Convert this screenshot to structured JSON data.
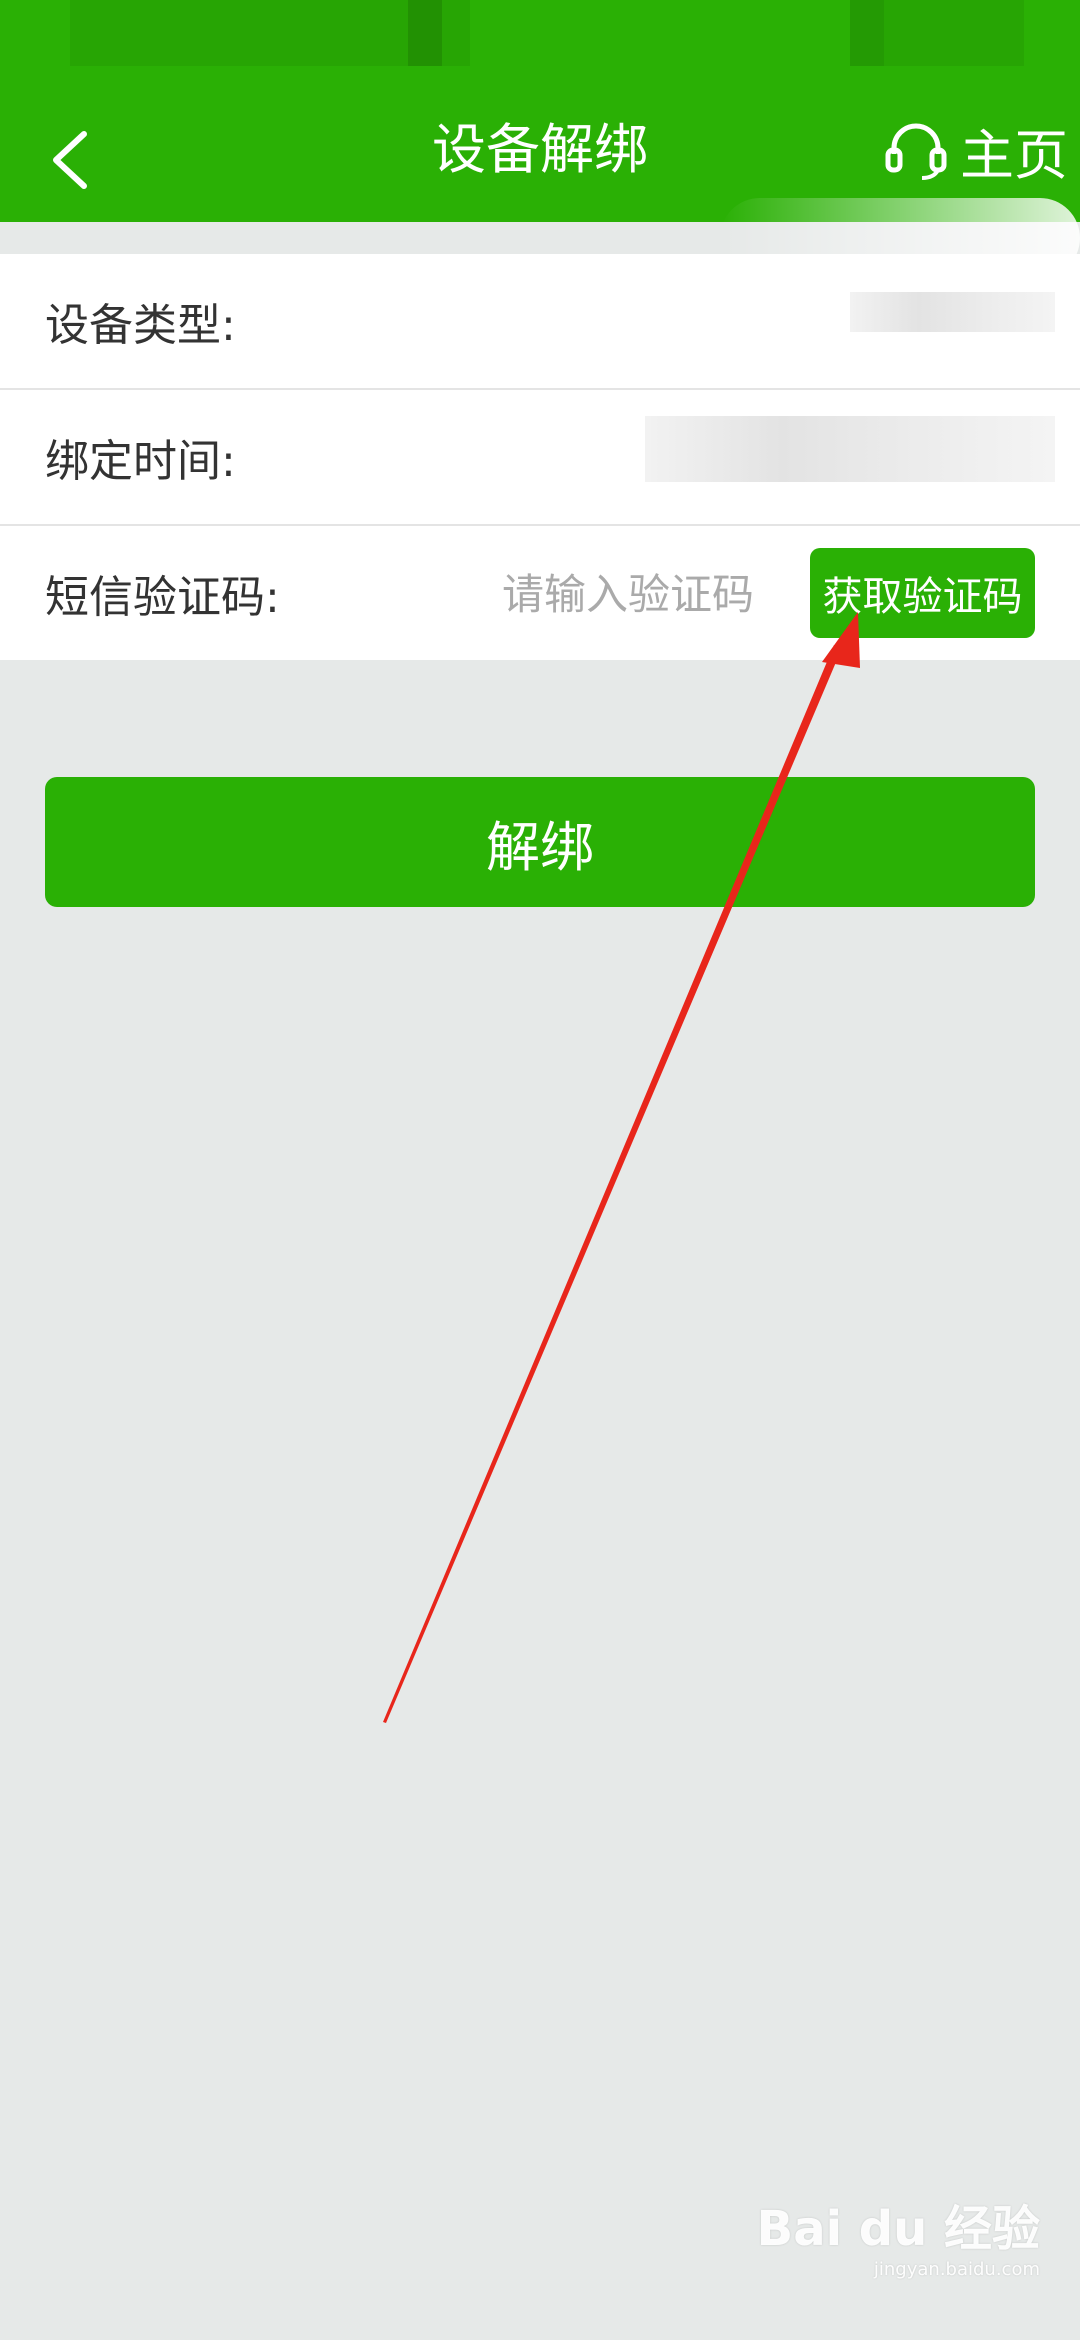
{
  "header": {
    "title": "设备解绑",
    "back_icon": "chevron-left-icon",
    "home_icon": "headset-icon",
    "home_label": "主页"
  },
  "form": {
    "device_type_label": "设备类型:",
    "bind_time_label": "绑定时间:",
    "sms_code_label": "短信验证码:",
    "sms_code_placeholder": "请输入验证码",
    "sms_code_value": "",
    "get_code_label": "获取验证码"
  },
  "actions": {
    "unbind_label": "解绑"
  },
  "watermark": {
    "logo": "Bai du 经验",
    "url": "jingyan.baidu.com"
  },
  "colors": {
    "brand_green": "#2ab005",
    "page_bg": "#e6e9e8",
    "annotation_red": "#e8261b"
  }
}
